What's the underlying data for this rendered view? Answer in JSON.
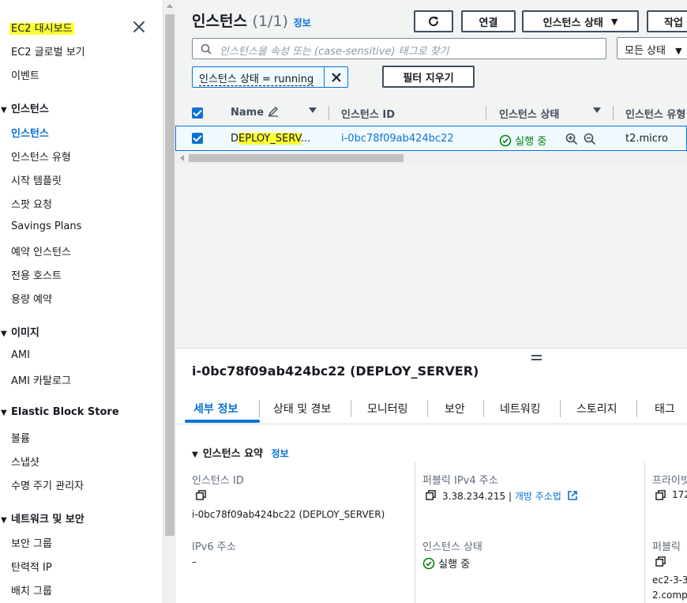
{
  "sidebar": {
    "items_top": [
      "EC2 대시보드",
      "EC2 글로벌 보기",
      "이벤트"
    ],
    "section_instances": "인스턴스",
    "instances_items": [
      "인스턴스",
      "인스턴스 유형",
      "시작 템플릿",
      "스팟 요청",
      "Savings Plans",
      "예약 인스턴스",
      "전용 호스트",
      "용량 예약"
    ],
    "section_images": "이미지",
    "images_items": [
      "AMI",
      "AMI 카탈로그"
    ],
    "section_ebs": "Elastic Block Store",
    "ebs_items": [
      "볼륨",
      "스냅샷",
      "수명 주기 관리자"
    ],
    "section_network": "네트워크 및 보안",
    "network_items": [
      "보안 그룹",
      "탄력적 IP",
      "배치 그룹"
    ]
  },
  "header": {
    "title": "인스턴스",
    "count": "(1/1)",
    "info": "정보",
    "btn_connect": "연결",
    "btn_state": "인스턴스 상태",
    "btn_actions": "작업"
  },
  "search": {
    "placeholder": "인스턴스을 속성 또는 (case-sensitive) 태그로 찾기",
    "state_filter": "모든 상태"
  },
  "filter": {
    "token": "인스턴스 상태 = running",
    "clear": "필터 지우기"
  },
  "table": {
    "columns": [
      "Name",
      "인스턴스 ID",
      "인스턴스 상태",
      "인스턴스 유형"
    ],
    "row": {
      "name_a": "D",
      "name_b": "EPLOY_SERV",
      "name_c": "...",
      "id": "i-0bc78f09ab424bc22",
      "state": "실행 중",
      "type": "t2.micro"
    }
  },
  "detail": {
    "title": "i-0bc78f09ab424bc22 (DEPLOY_SERVER)",
    "tabs": [
      "세부 정보",
      "상태 및 경보",
      "모니터링",
      "보안",
      "네트워킹",
      "스토리지",
      "태그"
    ],
    "summary_title": "인스턴스 요약",
    "summary_info": "정보",
    "instance_id_label": "인스턴스 ID",
    "instance_id_value": "i-0bc78f09ab424bc22 (DEPLOY_SERVER)",
    "ipv6_label": "IPv6 주소",
    "ipv6_value": "–",
    "public_ip_label": "퍼블릭 IPv4 주소",
    "public_ip_value": "3.38.234.215",
    "public_ip_sep": "|",
    "open_address": "개방 주소법",
    "state_label": "인스턴스 상태",
    "state_value": "실행 중",
    "private_label": "프라이빗",
    "private_value": "172",
    "public_dns_label": "퍼블릭",
    "public_dns_value_1": "ec2-3-3",
    "public_dns_value_2": "2.comp"
  },
  "colors": {
    "accent": "#0972d3",
    "success": "#037f0c",
    "highlight": "#ffff33"
  }
}
